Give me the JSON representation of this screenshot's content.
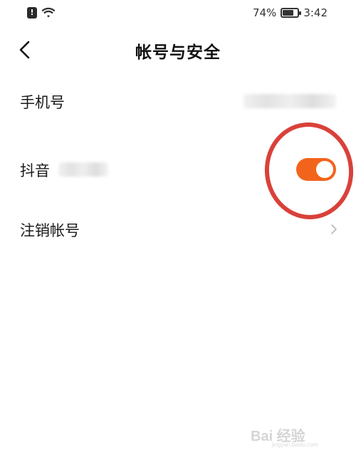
{
  "status_bar": {
    "alert_glyph": "!",
    "battery_percent": "74%",
    "time": "3:42"
  },
  "header": {
    "title": "帐号与安全"
  },
  "rows": {
    "phone": {
      "label": "手机号"
    },
    "douyin": {
      "label": "抖音",
      "toggle_on": true
    },
    "cancel": {
      "label": "注销帐号"
    }
  },
  "watermark": {
    "brand": "Bai 经验",
    "url": "jingyan.baidu.com"
  },
  "colors": {
    "toggle_on": "#f2641c",
    "highlight_ring": "#d9413a"
  }
}
